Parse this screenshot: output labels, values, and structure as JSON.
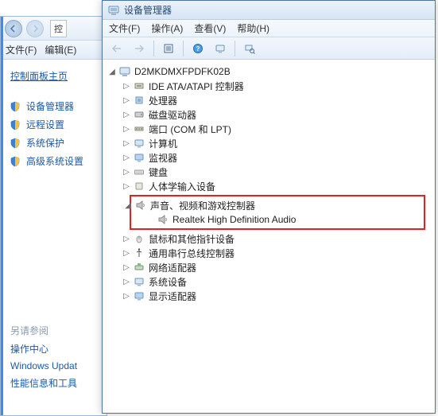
{
  "back_window": {
    "addr_frag": "控",
    "menu": {
      "file": "文件(F)",
      "edit": "编辑(E)"
    },
    "heading": "控制面板主页",
    "items": [
      {
        "label": "设备管理器",
        "icon": "monitor-icon"
      },
      {
        "label": "远程设置",
        "icon": "monitor-icon"
      },
      {
        "label": "系统保护",
        "icon": "shield-icon"
      },
      {
        "label": "高级系统设置",
        "icon": "shield-icon"
      }
    ],
    "see_also": "另请参阅",
    "links": [
      "操作中心",
      "Windows Updat",
      "性能信息和工具"
    ]
  },
  "front_window": {
    "title": "设备管理器",
    "menu": {
      "file": "文件(F)",
      "action": "操作(A)",
      "view": "查看(V)",
      "help": "帮助(H)"
    },
    "root": "D2MKDMXFPDFK02B",
    "categories": [
      {
        "label": "IDE ATA/ATAPI 控制器",
        "icon": "controller-icon"
      },
      {
        "label": "处理器",
        "icon": "cpu-icon"
      },
      {
        "label": "磁盘驱动器",
        "icon": "disk-icon"
      },
      {
        "label": "端口 (COM 和 LPT)",
        "icon": "port-icon"
      },
      {
        "label": "计算机",
        "icon": "computer-icon"
      },
      {
        "label": "监视器",
        "icon": "monitor-icon"
      },
      {
        "label": "键盘",
        "icon": "keyboard-icon"
      },
      {
        "label": "人体学输入设备",
        "icon": "hid-icon"
      }
    ],
    "highlighted": {
      "category": "声音、视频和游戏控制器",
      "device": "Realtek High Definition Audio"
    },
    "categories2": [
      {
        "label": "鼠标和其他指针设备",
        "icon": "mouse-icon"
      },
      {
        "label": "通用串行总线控制器",
        "icon": "usb-icon"
      },
      {
        "label": "网络适配器",
        "icon": "network-icon"
      },
      {
        "label": "系统设备",
        "icon": "system-icon"
      },
      {
        "label": "显示适配器",
        "icon": "display-icon"
      }
    ]
  }
}
